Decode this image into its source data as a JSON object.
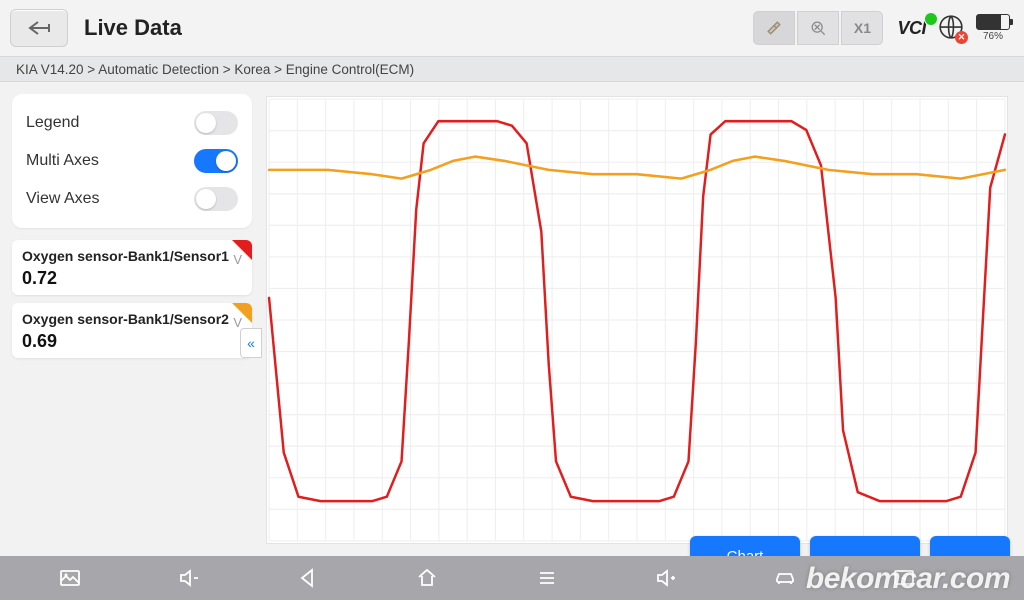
{
  "header": {
    "title": "Live Data",
    "battery_pct": "76%",
    "zoom_label": "X1"
  },
  "breadcrumb": "KIA V14.20 > Automatic Detection  > Korea  > Engine Control(ECM)",
  "options": {
    "legend": {
      "label": "Legend",
      "on": false
    },
    "multi_axes": {
      "label": "Multi Axes",
      "on": true
    },
    "view_axes": {
      "label": "View Axes",
      "on": false
    }
  },
  "sensors": [
    {
      "name": "Oxygen sensor-Bank1/Sensor1",
      "value": "0.72",
      "unit": "V",
      "color": "#e11d1d"
    },
    {
      "name": "Oxygen sensor-Bank1/Sensor2",
      "value": "0.69",
      "unit": "V",
      "color": "#f2a01e"
    }
  ],
  "buttons": {
    "chart": "Chart"
  },
  "watermark": "bekomcar.com",
  "chart_data": {
    "type": "line",
    "x_range": [
      0,
      100
    ],
    "y_range": [
      0,
      1.0
    ],
    "series": [
      {
        "name": "Oxygen sensor-Bank1/Sensor1",
        "color": "#e11d1d",
        "unit": "V",
        "points": [
          [
            0,
            0.55
          ],
          [
            2,
            0.2
          ],
          [
            4,
            0.1
          ],
          [
            7,
            0.09
          ],
          [
            11,
            0.09
          ],
          [
            14,
            0.09
          ],
          [
            16,
            0.1
          ],
          [
            18,
            0.18
          ],
          [
            19,
            0.45
          ],
          [
            20,
            0.75
          ],
          [
            21,
            0.9
          ],
          [
            23,
            0.95
          ],
          [
            27,
            0.95
          ],
          [
            31,
            0.95
          ],
          [
            33,
            0.94
          ],
          [
            35,
            0.9
          ],
          [
            37,
            0.7
          ],
          [
            38,
            0.4
          ],
          [
            39,
            0.18
          ],
          [
            41,
            0.1
          ],
          [
            44,
            0.09
          ],
          [
            49,
            0.09
          ],
          [
            53,
            0.09
          ],
          [
            55,
            0.1
          ],
          [
            57,
            0.18
          ],
          [
            58,
            0.45
          ],
          [
            59,
            0.78
          ],
          [
            60,
            0.92
          ],
          [
            62,
            0.95
          ],
          [
            67,
            0.95
          ],
          [
            71,
            0.95
          ],
          [
            73,
            0.93
          ],
          [
            75,
            0.85
          ],
          [
            77,
            0.55
          ],
          [
            78,
            0.25
          ],
          [
            80,
            0.11
          ],
          [
            83,
            0.09
          ],
          [
            88,
            0.09
          ],
          [
            92,
            0.09
          ],
          [
            94,
            0.1
          ],
          [
            96,
            0.2
          ],
          [
            97,
            0.5
          ],
          [
            98,
            0.8
          ],
          [
            100,
            0.92
          ]
        ]
      },
      {
        "name": "Oxygen sensor-Bank1/Sensor2",
        "color": "#f2a01e",
        "unit": "V",
        "points": [
          [
            0,
            0.84
          ],
          [
            8,
            0.84
          ],
          [
            14,
            0.83
          ],
          [
            18,
            0.82
          ],
          [
            22,
            0.84
          ],
          [
            25,
            0.86
          ],
          [
            28,
            0.87
          ],
          [
            32,
            0.86
          ],
          [
            38,
            0.84
          ],
          [
            44,
            0.83
          ],
          [
            50,
            0.83
          ],
          [
            56,
            0.82
          ],
          [
            60,
            0.84
          ],
          [
            63,
            0.86
          ],
          [
            66,
            0.87
          ],
          [
            70,
            0.86
          ],
          [
            76,
            0.84
          ],
          [
            82,
            0.83
          ],
          [
            88,
            0.83
          ],
          [
            94,
            0.82
          ],
          [
            97,
            0.83
          ],
          [
            100,
            0.84
          ]
        ]
      }
    ]
  }
}
